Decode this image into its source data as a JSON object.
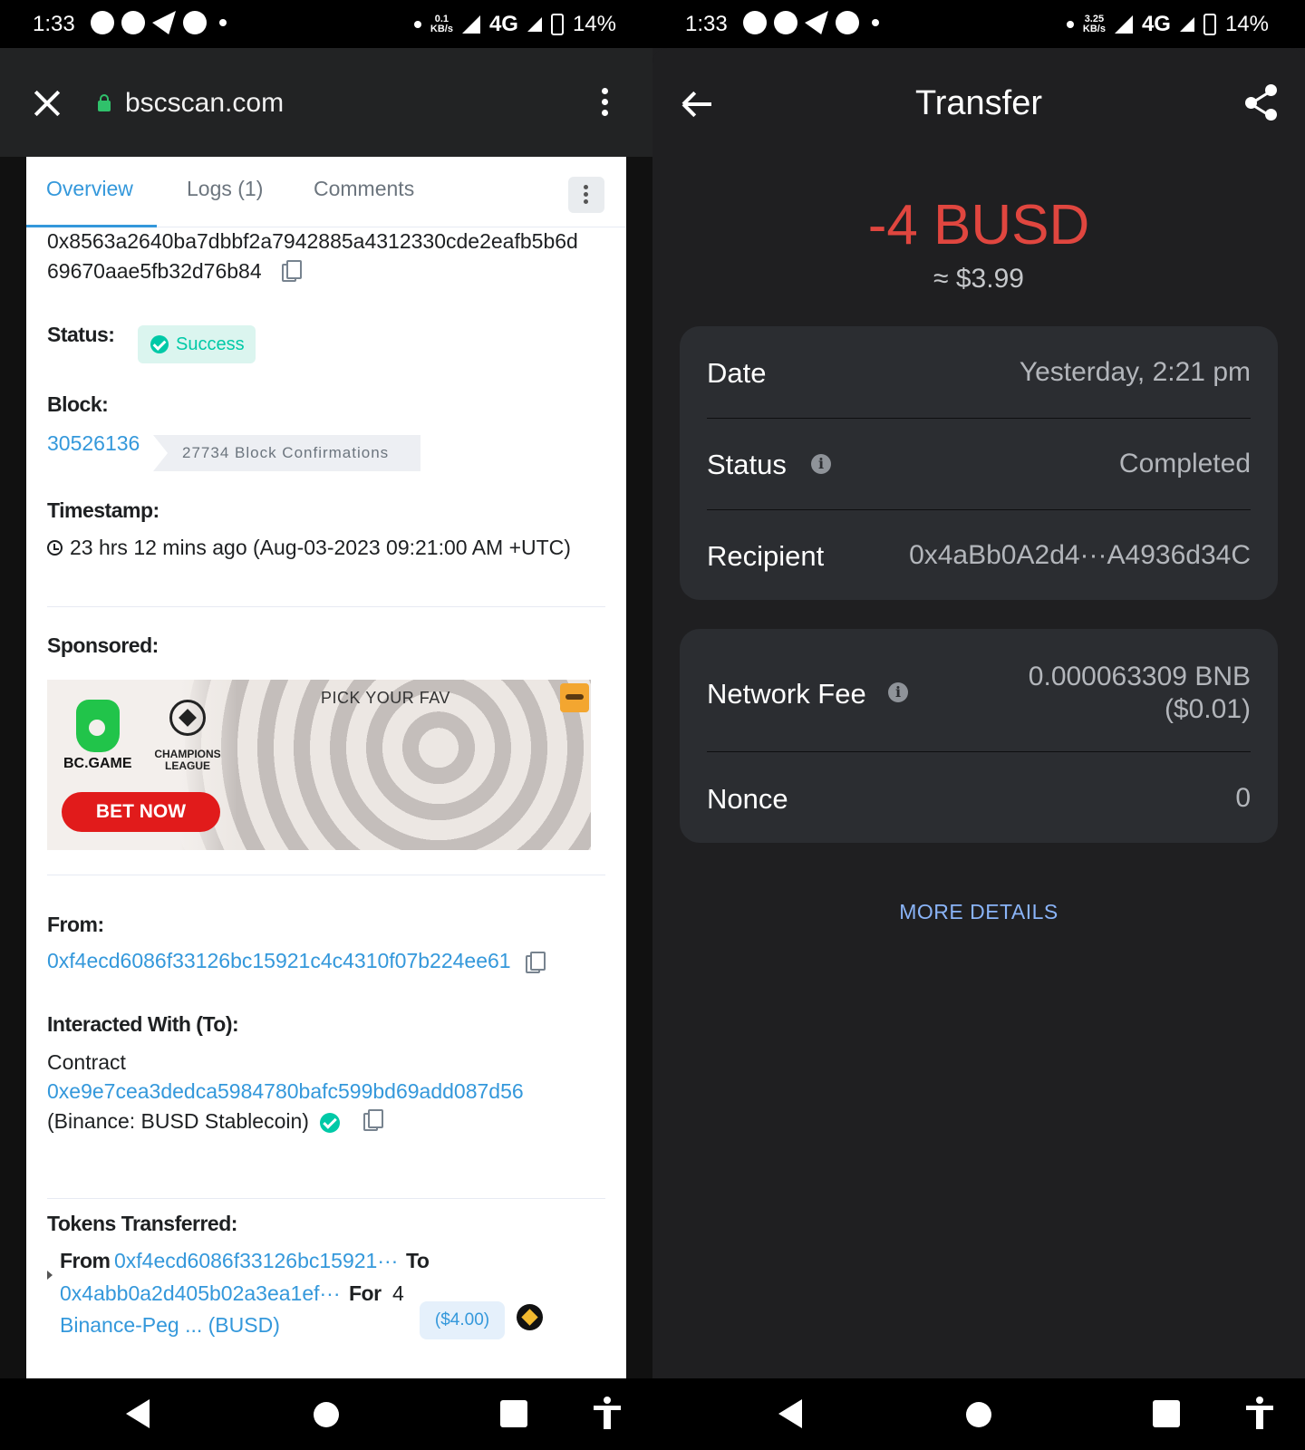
{
  "status_bar_left": {
    "time": "1:33",
    "speed": "0.1",
    "speed_unit": "KB/s",
    "network": "4G",
    "battery": "14%"
  },
  "status_bar_right": {
    "time": "1:33",
    "speed": "3.25",
    "speed_unit": "KB/s",
    "network": "4G",
    "battery": "14%"
  },
  "browser": {
    "url": "bscscan.com"
  },
  "tabs": [
    "Overview",
    "Logs (1)",
    "Comments"
  ],
  "tx": {
    "hash_line1": "0x8563a2640ba7dbbf2a7942885a4312330cde2eafb5b6d",
    "hash_line2": "69670aae5fb32d76b84",
    "status_label": "Status:",
    "status_value": "Success",
    "block_label": "Block:",
    "block_number": "30526136",
    "block_confirmations": "27734 Block Confirmations",
    "timestamp_label": "Timestamp:",
    "timestamp_value": "23 hrs 12 mins ago (Aug-03-2023 09:21:00 AM +UTC)",
    "sponsored_label": "Sponsored:",
    "from_label": "From:",
    "from_address": "0xf4ecd6086f33126bc15921c4c4310f07b224ee61",
    "interacted_label": "Interacted With (To):",
    "contract_label": "Contract",
    "contract_address": "0xe9e7cea3dedca5984780bafc599bd69add087d56",
    "contract_name": "(Binance: BUSD Stablecoin)",
    "tokens_label": "Tokens Transferred:",
    "token_from_word": "From",
    "token_from_addr": "0xf4ecd6086f33126bc15921···",
    "token_to_word": "To",
    "token_to_addr": "0x4abb0a2d405b02a3ea1ef···",
    "token_for_word": "For",
    "token_amount": "4",
    "token_usd": "($4.00)",
    "token_name": "Binance-Peg ... (BUSD)"
  },
  "ad": {
    "brand": "BC.GAME",
    "league_line1": "CHAMPIONS",
    "league_line2": "LEAGUE",
    "headline": "PICK YOUR FAV",
    "cta": "BET NOW"
  },
  "wallet": {
    "title": "Transfer",
    "amount": "-4 BUSD",
    "amount_usd": "≈ $3.99",
    "date_label": "Date",
    "date_value": "Yesterday, 2:21 pm",
    "status_label": "Status",
    "status_value": "Completed",
    "recipient_label": "Recipient",
    "recipient_value": "0x4aBb0A2d4···A4936d34C",
    "fee_label": "Network Fee",
    "fee_value_line1": "0.000063309 BNB",
    "fee_value_line2": "($0.01)",
    "nonce_label": "Nonce",
    "nonce_value": "0",
    "more_details": "MORE DETAILS"
  },
  "colors": {
    "link": "#3498db",
    "success": "#00c9a7",
    "negative_amount": "#e0463f",
    "more_details": "#8ab4f8"
  }
}
